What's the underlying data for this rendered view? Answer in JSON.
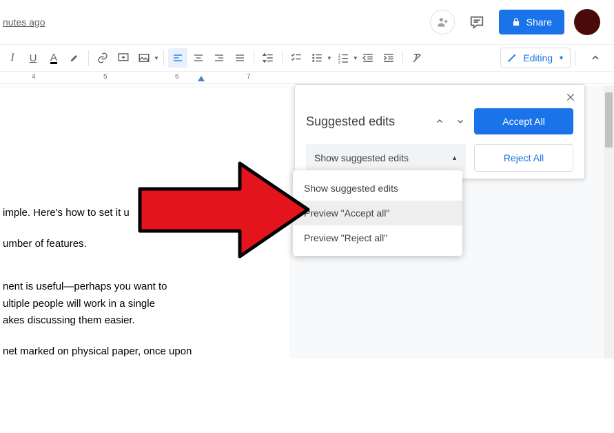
{
  "header": {
    "last_edit": "nutes ago",
    "share_label": "Share"
  },
  "toolbar": {
    "editing_label": "Editing"
  },
  "ruler": {
    "n4": "4",
    "n5": "5",
    "n6": "6",
    "n7": "7"
  },
  "doc": {
    "p1": "imple. Here's how to set it u",
    "p2": "umber of features.",
    "p3": "nent is useful—perhaps you want to",
    "p4": "ultiple people will work in a single",
    "p5": "akes discussing them easier.",
    "p6": "net marked on physical paper, once upon"
  },
  "panel": {
    "title": "Suggested edits",
    "accept_all": "Accept All",
    "reject_all": "Reject All",
    "select_label": "Show suggested edits"
  },
  "menu": {
    "opt1": "Show suggested edits",
    "opt2": "Preview \"Accept all\"",
    "opt3": "Preview \"Reject all\""
  }
}
